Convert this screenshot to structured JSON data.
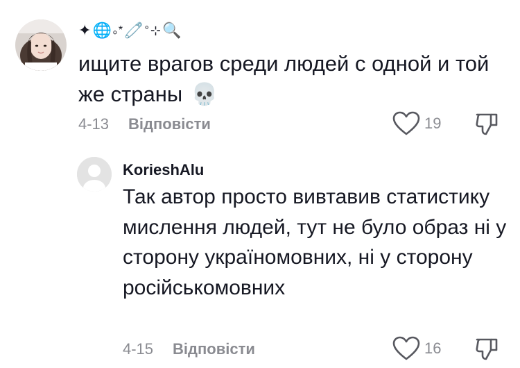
{
  "comments": [
    {
      "username_symbols": [
        "✦",
        "🌐",
        "｡*",
        "🧷",
        "°",
        "⊹",
        "🔍"
      ],
      "text": "ищите врагов среди людей с одной и той же страны",
      "emoji": "💀",
      "date": "4-13",
      "reply_label": "Відповісти",
      "likes": "19",
      "icons": {
        "like": "heart-outline-icon",
        "dislike": "thumbs-down-icon"
      }
    },
    {
      "username": "KorieshAlu",
      "text": "Так автор просто вивтавив статистику мислення людей, тут не було образ ні у сторону україномовних, ні у сторону російськомовних",
      "date": "4-15",
      "reply_label": "Відповісти",
      "likes": "16",
      "icons": {
        "like": "heart-outline-icon",
        "dislike": "thumbs-down-icon"
      }
    }
  ],
  "colors": {
    "primary_text": "#161823",
    "secondary_text": "#8a8b91",
    "icon": "#57585f",
    "default_avatar": "#e3e3e3"
  }
}
